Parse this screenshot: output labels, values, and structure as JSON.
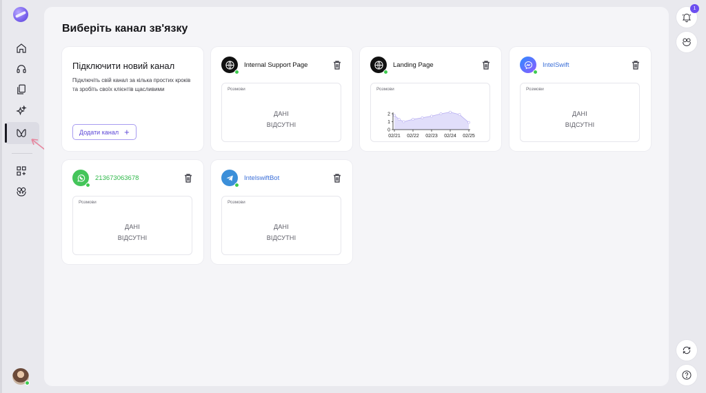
{
  "page": {
    "title": "Виберіть канал зв'язку"
  },
  "sidebar": {
    "items": [
      {
        "icon": "home-icon"
      },
      {
        "icon": "headset-icon"
      },
      {
        "icon": "documents-icon"
      },
      {
        "icon": "sparkles-icon"
      },
      {
        "icon": "channels-icon",
        "active": true
      },
      {
        "icon": "apps-add-icon"
      },
      {
        "icon": "bot-icon"
      }
    ]
  },
  "new_channel": {
    "title": "Підключити новий канал",
    "description": "Підключіть свій канал за кілька простих кроків та зробіть своїх клієнтів щасливими",
    "button_label": "Додати канал",
    "button_icon": "plus-icon"
  },
  "channels": [
    {
      "name": "Internal Support Page",
      "type": "web",
      "icon": "globe-icon",
      "name_color": "#111111",
      "stat_label": "Розмови",
      "empty_line1": "ДАНІ",
      "empty_line2": "ВІДСУТНІ"
    },
    {
      "name": "Landing Page",
      "type": "web",
      "icon": "globe-icon",
      "name_color": "#111111",
      "stat_label": "Розмови"
    },
    {
      "name": "IntelSwift",
      "type": "messenger",
      "icon": "messenger-icon",
      "name_color": "#3b6fd8",
      "stat_label": "Розмови",
      "empty_line1": "ДАНІ",
      "empty_line2": "ВІДСУТНІ"
    },
    {
      "name": "213673063678",
      "type": "whatsapp",
      "icon": "whatsapp-icon",
      "name_color": "#2fb84a",
      "stat_label": "Розмови",
      "empty_line1": "ДАНІ",
      "empty_line2": "ВІДСУТНІ"
    },
    {
      "name": "IntelswiftBot",
      "type": "telegram",
      "icon": "telegram-icon",
      "name_color": "#3b6fd8",
      "stat_label": "Розмови",
      "empty_line1": "ДАНІ",
      "empty_line2": "ВІДСУТНІ"
    }
  ],
  "chart_data": {
    "type": "area",
    "x": [
      "02/21",
      "02/22",
      "02/23",
      "02/24",
      "02/25"
    ],
    "ticks_y": [
      0,
      1,
      2
    ],
    "ylim": [
      0,
      2
    ],
    "series_color": "#c9c2f5",
    "points": [
      {
        "x": 0.0,
        "y": 1.8
      },
      {
        "x": 0.25,
        "y": 1.3
      },
      {
        "x": 0.5,
        "y": 1.0
      },
      {
        "x": 1.0,
        "y": 1.3
      },
      {
        "x": 1.5,
        "y": 1.5
      },
      {
        "x": 2.0,
        "y": 1.7
      },
      {
        "x": 2.5,
        "y": 2.0
      },
      {
        "x": 3.0,
        "y": 2.2
      },
      {
        "x": 3.5,
        "y": 1.9
      },
      {
        "x": 4.0,
        "y": 0.9
      }
    ]
  },
  "right_rail": {
    "notifications_count": "1",
    "icons": [
      "bell-icon",
      "bot-icon",
      "refresh-icon",
      "help-icon"
    ]
  }
}
